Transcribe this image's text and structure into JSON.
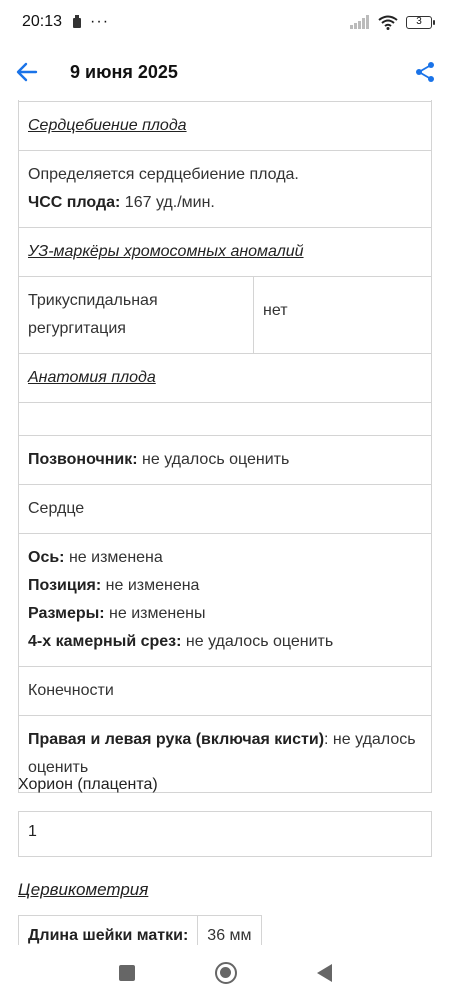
{
  "status_bar": {
    "time": "20:13",
    "battery": "3"
  },
  "app_bar": {
    "title": "9 июня 2025"
  },
  "sections": {
    "heartbeat": {
      "title": "Сердцебиение плода",
      "text": "Определяется сердцебиение плода.",
      "hr_label": "ЧСС плода:",
      "hr_value": " 167 уд./мин."
    },
    "markers": {
      "title": "УЗ-маркёры хромосомных аномалий",
      "tricuspid_label": "Трикуспидальная регургитация",
      "tricuspid_value": "нет"
    },
    "anatomy": {
      "title": "Анатомия плода",
      "spine_label": "Позвоночник:",
      "spine_value": " не удалось оценить",
      "heart_title": "Сердце",
      "axis_label": "Ось:",
      "axis_value": " не изменена",
      "position_label": "Позиция:",
      "position_value": " не изменена",
      "size_label": "Размеры:",
      "size_value": " не изменены",
      "four_chamber_label": "4-х камерный срез:",
      "four_chamber_value": " не удалось оценить",
      "limbs_title": "Конечности",
      "arms_label": "Правая и левая рука (включая кисти)",
      "arms_value": ": не удалось оценить"
    }
  },
  "chorion": {
    "label": "Хорион (плацента)",
    "value": "1"
  },
  "cervicometry": {
    "title": "Цервикометрия",
    "length_label": "Длина шейки матки:",
    "length_value": "36 мм"
  },
  "colors": {
    "accent": "#1a73e8"
  }
}
